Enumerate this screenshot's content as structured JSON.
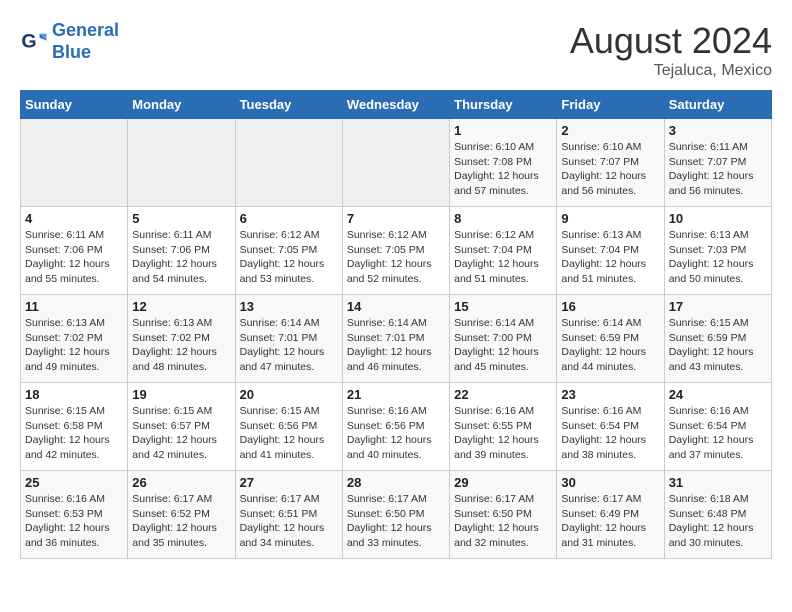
{
  "logo": {
    "line1": "General",
    "line2": "Blue"
  },
  "title": "August 2024",
  "location": "Tejaluca, Mexico",
  "days_of_week": [
    "Sunday",
    "Monday",
    "Tuesday",
    "Wednesday",
    "Thursday",
    "Friday",
    "Saturday"
  ],
  "weeks": [
    [
      {
        "day": "",
        "empty": true
      },
      {
        "day": "",
        "empty": true
      },
      {
        "day": "",
        "empty": true
      },
      {
        "day": "",
        "empty": true
      },
      {
        "day": "1",
        "sunrise": "6:10 AM",
        "sunset": "7:08 PM",
        "daylight": "12 hours and 57 minutes."
      },
      {
        "day": "2",
        "sunrise": "6:10 AM",
        "sunset": "7:07 PM",
        "daylight": "12 hours and 56 minutes."
      },
      {
        "day": "3",
        "sunrise": "6:11 AM",
        "sunset": "7:07 PM",
        "daylight": "12 hours and 56 minutes."
      }
    ],
    [
      {
        "day": "4",
        "sunrise": "6:11 AM",
        "sunset": "7:06 PM",
        "daylight": "12 hours and 55 minutes."
      },
      {
        "day": "5",
        "sunrise": "6:11 AM",
        "sunset": "7:06 PM",
        "daylight": "12 hours and 54 minutes."
      },
      {
        "day": "6",
        "sunrise": "6:12 AM",
        "sunset": "7:05 PM",
        "daylight": "12 hours and 53 minutes."
      },
      {
        "day": "7",
        "sunrise": "6:12 AM",
        "sunset": "7:05 PM",
        "daylight": "12 hours and 52 minutes."
      },
      {
        "day": "8",
        "sunrise": "6:12 AM",
        "sunset": "7:04 PM",
        "daylight": "12 hours and 51 minutes."
      },
      {
        "day": "9",
        "sunrise": "6:13 AM",
        "sunset": "7:04 PM",
        "daylight": "12 hours and 51 minutes."
      },
      {
        "day": "10",
        "sunrise": "6:13 AM",
        "sunset": "7:03 PM",
        "daylight": "12 hours and 50 minutes."
      }
    ],
    [
      {
        "day": "11",
        "sunrise": "6:13 AM",
        "sunset": "7:02 PM",
        "daylight": "12 hours and 49 minutes."
      },
      {
        "day": "12",
        "sunrise": "6:13 AM",
        "sunset": "7:02 PM",
        "daylight": "12 hours and 48 minutes."
      },
      {
        "day": "13",
        "sunrise": "6:14 AM",
        "sunset": "7:01 PM",
        "daylight": "12 hours and 47 minutes."
      },
      {
        "day": "14",
        "sunrise": "6:14 AM",
        "sunset": "7:01 PM",
        "daylight": "12 hours and 46 minutes."
      },
      {
        "day": "15",
        "sunrise": "6:14 AM",
        "sunset": "7:00 PM",
        "daylight": "12 hours and 45 minutes."
      },
      {
        "day": "16",
        "sunrise": "6:14 AM",
        "sunset": "6:59 PM",
        "daylight": "12 hours and 44 minutes."
      },
      {
        "day": "17",
        "sunrise": "6:15 AM",
        "sunset": "6:59 PM",
        "daylight": "12 hours and 43 minutes."
      }
    ],
    [
      {
        "day": "18",
        "sunrise": "6:15 AM",
        "sunset": "6:58 PM",
        "daylight": "12 hours and 42 minutes."
      },
      {
        "day": "19",
        "sunrise": "6:15 AM",
        "sunset": "6:57 PM",
        "daylight": "12 hours and 42 minutes."
      },
      {
        "day": "20",
        "sunrise": "6:15 AM",
        "sunset": "6:56 PM",
        "daylight": "12 hours and 41 minutes."
      },
      {
        "day": "21",
        "sunrise": "6:16 AM",
        "sunset": "6:56 PM",
        "daylight": "12 hours and 40 minutes."
      },
      {
        "day": "22",
        "sunrise": "6:16 AM",
        "sunset": "6:55 PM",
        "daylight": "12 hours and 39 minutes."
      },
      {
        "day": "23",
        "sunrise": "6:16 AM",
        "sunset": "6:54 PM",
        "daylight": "12 hours and 38 minutes."
      },
      {
        "day": "24",
        "sunrise": "6:16 AM",
        "sunset": "6:54 PM",
        "daylight": "12 hours and 37 minutes."
      }
    ],
    [
      {
        "day": "25",
        "sunrise": "6:16 AM",
        "sunset": "6:53 PM",
        "daylight": "12 hours and 36 minutes."
      },
      {
        "day": "26",
        "sunrise": "6:17 AM",
        "sunset": "6:52 PM",
        "daylight": "12 hours and 35 minutes."
      },
      {
        "day": "27",
        "sunrise": "6:17 AM",
        "sunset": "6:51 PM",
        "daylight": "12 hours and 34 minutes."
      },
      {
        "day": "28",
        "sunrise": "6:17 AM",
        "sunset": "6:50 PM",
        "daylight": "12 hours and 33 minutes."
      },
      {
        "day": "29",
        "sunrise": "6:17 AM",
        "sunset": "6:50 PM",
        "daylight": "12 hours and 32 minutes."
      },
      {
        "day": "30",
        "sunrise": "6:17 AM",
        "sunset": "6:49 PM",
        "daylight": "12 hours and 31 minutes."
      },
      {
        "day": "31",
        "sunrise": "6:18 AM",
        "sunset": "6:48 PM",
        "daylight": "12 hours and 30 minutes."
      }
    ]
  ],
  "labels": {
    "sunrise": "Sunrise:",
    "sunset": "Sunset:",
    "daylight": "Daylight:"
  }
}
